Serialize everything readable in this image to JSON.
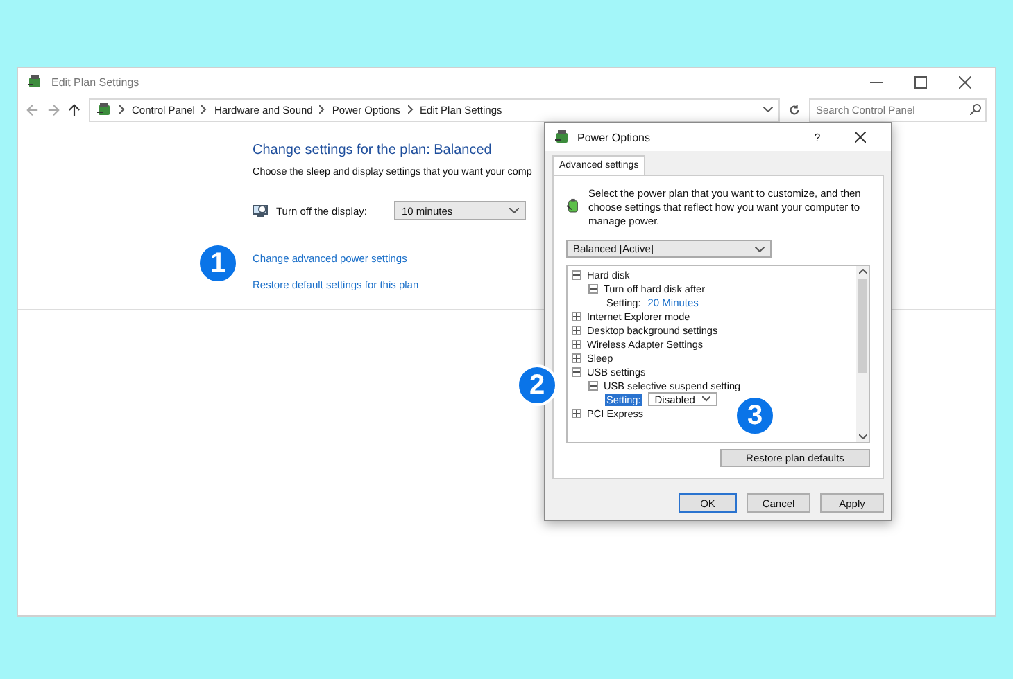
{
  "window": {
    "title": "Edit Plan Settings"
  },
  "breadcrumb": [
    "Control Panel",
    "Hardware and Sound",
    "Power Options",
    "Edit Plan Settings"
  ],
  "search": {
    "placeholder": "Search Control Panel"
  },
  "plan": {
    "heading": "Change settings for the plan: Balanced",
    "description": "Choose the sleep and display settings that you want your comp",
    "display": {
      "label": "Turn off the display:",
      "value": "10 minutes"
    },
    "links": [
      "Change advanced power settings",
      "Restore default settings for this plan"
    ]
  },
  "dialog": {
    "title": "Power Options",
    "help": "?",
    "tabs": [
      {
        "label": "Advanced settings",
        "selected": true
      }
    ],
    "intro": "Select the power plan that you want to customize, and then choose settings that reflect how you want your computer to manage power.",
    "plan_select": "Balanced [Active]",
    "tree": [
      {
        "label": "Hard disk",
        "expanded": true,
        "children": [
          {
            "label": "Turn off hard disk after",
            "expanded": true,
            "children": [
              {
                "kind": "value",
                "label": "Setting:",
                "value": "20 Minutes",
                "selected": false
              }
            ]
          }
        ]
      },
      {
        "label": "Internet Explorer mode",
        "expanded": false
      },
      {
        "label": "Desktop background settings",
        "expanded": false
      },
      {
        "label": "Wireless Adapter Settings",
        "expanded": false
      },
      {
        "label": "Sleep",
        "expanded": false
      },
      {
        "label": "USB settings",
        "expanded": true,
        "children": [
          {
            "label": "USB selective suspend setting",
            "expanded": true,
            "children": [
              {
                "kind": "select",
                "label": "Setting:",
                "value": "Disabled",
                "selected": true
              }
            ]
          }
        ]
      },
      {
        "label": "PCI Express",
        "expanded": false
      }
    ],
    "restore_button": "Restore plan defaults",
    "buttons": [
      {
        "label": "OK",
        "default": true
      },
      {
        "label": "Cancel",
        "default": false
      },
      {
        "label": "Apply",
        "default": false
      }
    ]
  },
  "callouts": [
    {
      "label": "1"
    },
    {
      "label": "2"
    },
    {
      "label": "3"
    }
  ]
}
